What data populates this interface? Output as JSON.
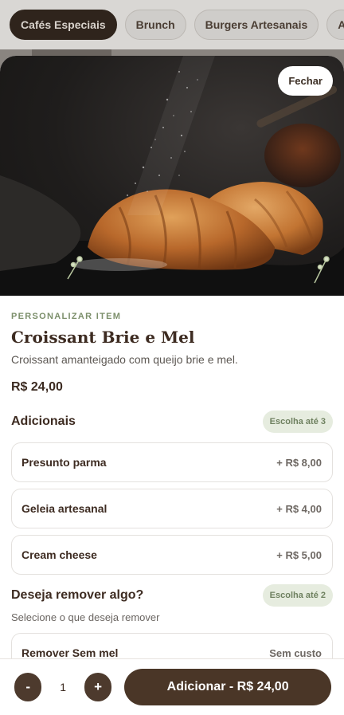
{
  "categories": [
    {
      "label": "Cafés Especiais",
      "active": true
    },
    {
      "label": "Brunch",
      "active": false
    },
    {
      "label": "Burgers Artesanais",
      "active": false
    },
    {
      "label": "A",
      "active": false
    }
  ],
  "sheet": {
    "close_label": "Fechar",
    "eyebrow": "PERSONALIZAR ITEM",
    "title": "Croissant Brie e Mel",
    "description": "Croissant amanteigado com queijo brie e mel.",
    "price": "R$ 24,00"
  },
  "addons": {
    "title": "Adicionais",
    "limit": "Escolha até 3",
    "items": [
      {
        "name": "Presunto parma",
        "price": "+ R$ 8,00"
      },
      {
        "name": "Geleia artesanal",
        "price": "+ R$ 4,00"
      },
      {
        "name": "Cream cheese",
        "price": "+ R$ 5,00"
      }
    ]
  },
  "remove": {
    "title": "Deseja remover algo?",
    "limit": "Escolha até 2",
    "subtitle": "Selecione o que deseja remover",
    "items": [
      {
        "name": "Remover Sem mel",
        "price": "Sem custo"
      }
    ]
  },
  "footer": {
    "minus": "-",
    "quantity": "1",
    "plus": "+",
    "add_label": "Adicionar - R$ 24,00"
  },
  "colors": {
    "brand_dark": "#4a3627",
    "accent_green": "#7c8f6b",
    "badge_bg": "#e6ecdf"
  }
}
